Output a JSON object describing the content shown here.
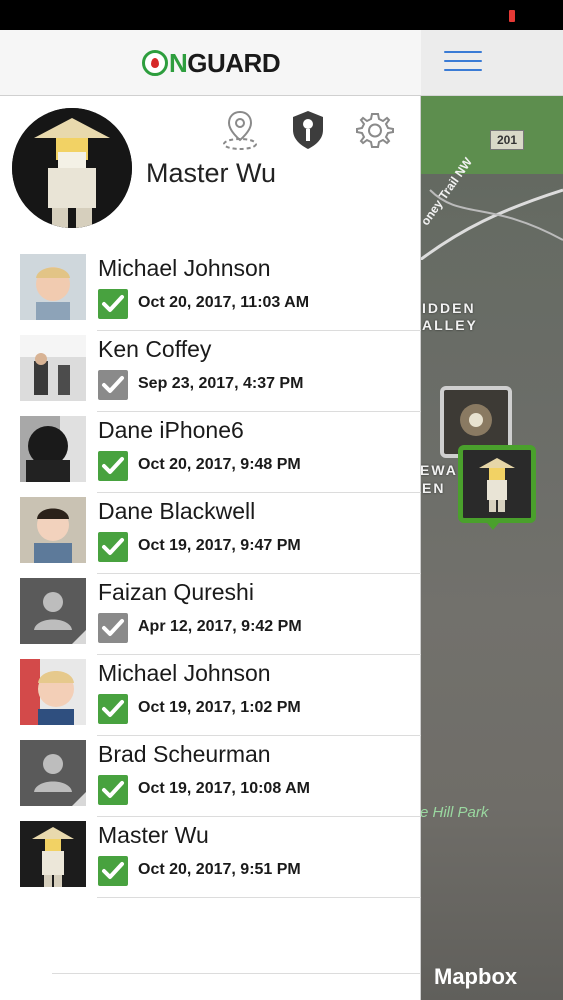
{
  "app": {
    "logo": {
      "first": "O",
      "n": "N",
      "rest": "GUARD"
    }
  },
  "profile": {
    "name": "Master Wu"
  },
  "tools": [
    {
      "name": "location-history-icon"
    },
    {
      "name": "shield-icon"
    },
    {
      "name": "gear-icon"
    }
  ],
  "contacts": [
    {
      "name": "Michael Johnson",
      "time": "Oct 20, 2017, 11:03 AM",
      "checked": true
    },
    {
      "name": "Ken Coffey",
      "time": "Sep 23, 2017, 4:37 PM",
      "checked": false
    },
    {
      "name": "Dane iPhone6",
      "time": "Oct 20, 2017, 9:48 PM",
      "checked": true
    },
    {
      "name": "Dane Blackwell",
      "time": "Oct 19, 2017, 9:47 PM",
      "checked": true
    },
    {
      "name": "Faizan Qureshi",
      "time": "Apr 12, 2017, 9:42 PM",
      "checked": false
    },
    {
      "name": "Michael Johnson",
      "time": "Oct 19, 2017, 1:02 PM",
      "checked": true
    },
    {
      "name": "Brad Scheurman",
      "time": "Oct 19, 2017, 10:08 AM",
      "checked": true
    },
    {
      "name": "Master Wu",
      "time": "Oct 20, 2017, 9:51 PM",
      "checked": true
    }
  ],
  "map": {
    "route_shield": "201",
    "trail_label": "oney Trail NW",
    "area_label_1": "IDDEN",
    "area_label_2": "ALLEY",
    "area_label_3": "EWA",
    "area_label_4": "EN",
    "park_label": "e Hill Park",
    "attribution": "Mapbox"
  },
  "colors": {
    "check_on": "#48a23f",
    "check_off": "#8a8a8a",
    "accent_blue": "#3a7bd5",
    "brand_green": "#2e9e3e"
  }
}
